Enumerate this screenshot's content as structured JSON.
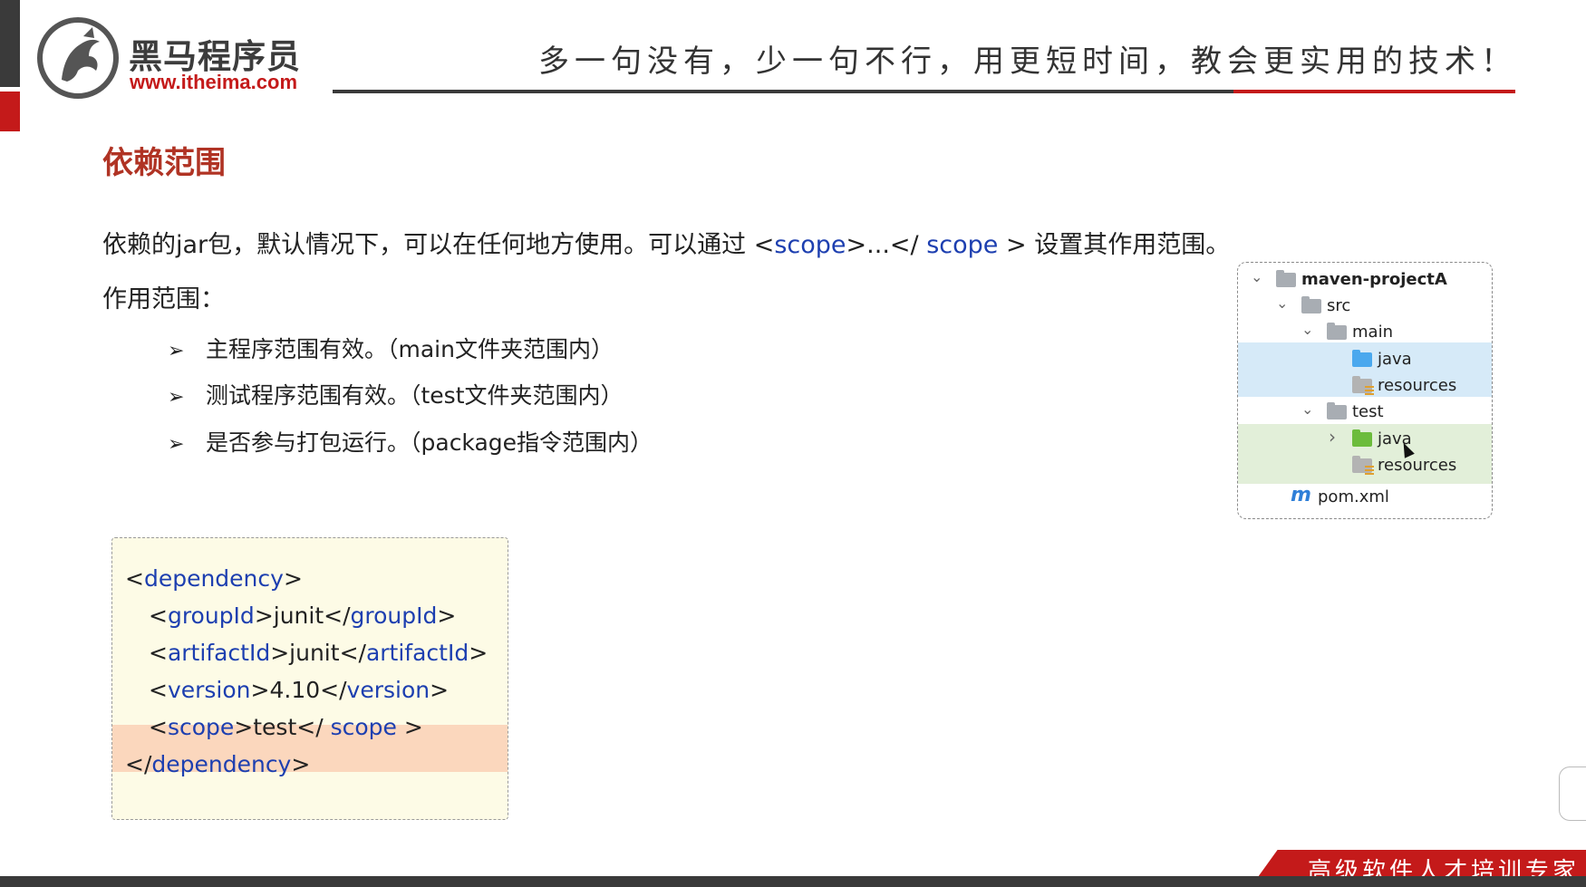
{
  "header": {
    "logo_cn": "黑马程序员",
    "logo_url": "www.itheima.com",
    "slogan": "多一句没有，少一句不行，用更短时间，教会更实用的技术！"
  },
  "slide": {
    "title": "依赖范围",
    "desc_prefix": "依赖的jar包，默认情况下，可以在任何地方使用。可以通过 <",
    "desc_kw1": "scope",
    "desc_mid": ">...</ ",
    "desc_kw2": "scope",
    "desc_suffix": " > 设置其作用范围。",
    "scope_label": "作用范围：",
    "bullet_symbol": "➢",
    "bullets": [
      "主程序范围有效。（main文件夹范围内）",
      "测试程序范围有效。（test文件夹范围内）",
      "是否参与打包运行。（package指令范围内）"
    ]
  },
  "code": {
    "lt": "<",
    "gt": ">",
    "lt_close": "</",
    "gt_space": " >",
    "lt_close_space": "</ ",
    "dependency": "dependency",
    "groupId": "groupId",
    "groupId_value": "junit",
    "artifactId": "artifactId",
    "artifactId_value": "junit",
    "version": "version",
    "version_value": "4.10",
    "scope": "scope",
    "scope_value": "test",
    "scope_close": "scope"
  },
  "tree": {
    "chev_down": "⌄",
    "chev_right": "›",
    "items": [
      {
        "label": "maven-projectA"
      },
      {
        "label": "src"
      },
      {
        "label": "main"
      },
      {
        "label": "java"
      },
      {
        "label": "resources"
      },
      {
        "label": "test"
      },
      {
        "label": "java"
      },
      {
        "label": "resources"
      },
      {
        "label": "pom.xml",
        "icon_text": "m"
      }
    ],
    "colors": {
      "main_highlight": "#d6eaf8",
      "test_highlight": "#e2efd9"
    }
  },
  "footer": {
    "slogan": "高级软件人才培训专家"
  }
}
